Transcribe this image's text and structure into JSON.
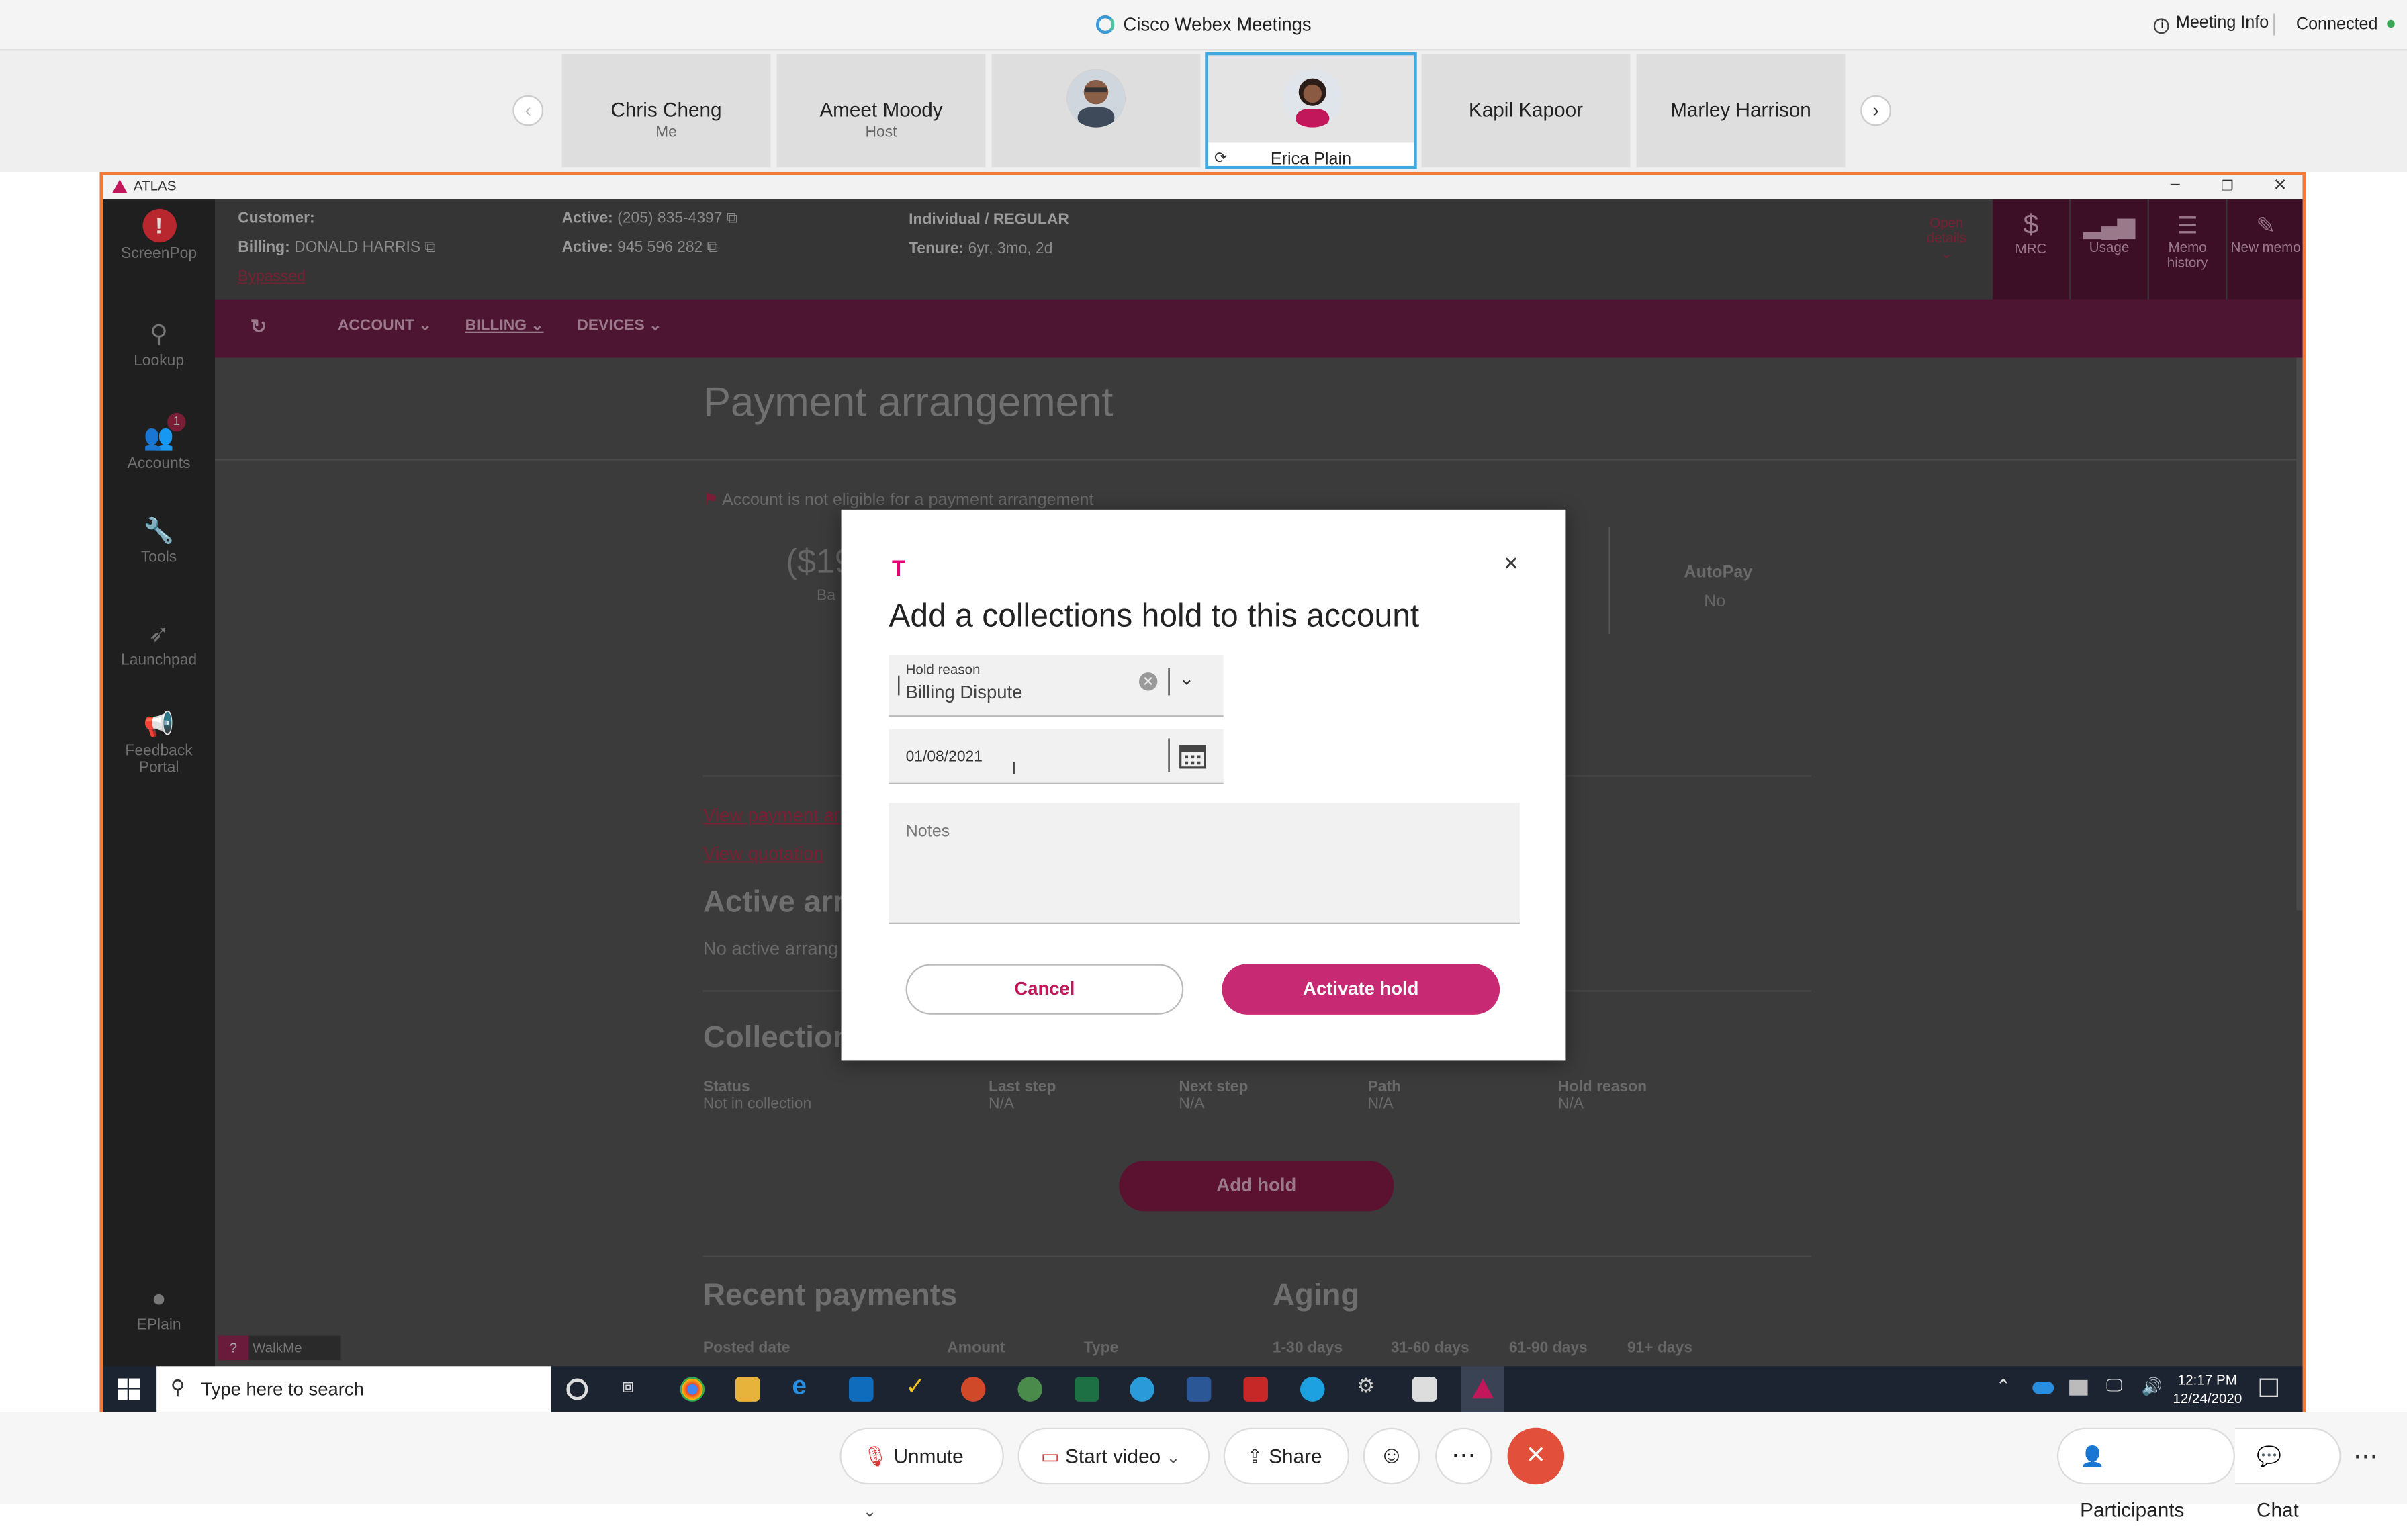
{
  "webex": {
    "app_title": "Cisco Webex Meetings",
    "meeting_info": "Meeting Info",
    "status": "Connected"
  },
  "participants": [
    {
      "name": "Chris Cheng",
      "role": "Me"
    },
    {
      "name": "Ameet Moody",
      "role": "Host"
    },
    {
      "name": "",
      "role": ""
    },
    {
      "name": "Erica Plain",
      "role": ""
    },
    {
      "name": "Kapil Kapoor",
      "role": ""
    },
    {
      "name": "Marley Harrison",
      "role": ""
    }
  ],
  "atlas": {
    "window_title": "ATLAS",
    "sidebar": [
      "ScreenPop",
      "Lookup",
      "Accounts",
      "Tools",
      "Launchpad",
      "Feedback Portal",
      "EPlain"
    ],
    "accounts_badge": "1",
    "customer": {
      "customer_label": "Customer:",
      "billing_label": "Billing:",
      "billing_name": "DONALD HARRIS",
      "bypassed": "Bypassed",
      "active_label": "Active:",
      "active1": "(205) 835-4397",
      "active2": "945 596 282",
      "type": "Individual",
      "plan": "REGULAR",
      "tenure_label": "Tenure:",
      "tenure": "6yr, 3mo, 2d"
    },
    "header_actions": [
      "Open details",
      "MRC",
      "Usage",
      "Memo history",
      "New memo"
    ],
    "nav": [
      "ACCOUNT",
      "BILLING",
      "DEVICES"
    ],
    "page": {
      "title": "Payment arrangement",
      "not_eligible": "Account is not eligible for a payment arrangement",
      "balance_partial": "($19",
      "balance_label_partial": "Ba",
      "autopay_label": "AutoPay",
      "autopay_value": "No",
      "link_view_payment": "View payment ar",
      "link_view_quotation": "View quotation",
      "active_arrangements": "Active arra",
      "no_active": "No active arrang",
      "collections": "Collection",
      "collections_cols": [
        {
          "label": "Status",
          "value": "Not in collection"
        },
        {
          "label": "Last step",
          "value": "N/A"
        },
        {
          "label": "Next step",
          "value": "N/A"
        },
        {
          "label": "Path",
          "value": "N/A"
        },
        {
          "label": "Hold reason",
          "value": "N/A"
        }
      ],
      "add_hold": "Add hold",
      "recent_payments": "Recent payments",
      "payments_cols": [
        "Posted date",
        "Amount",
        "Type"
      ],
      "aging": "Aging",
      "aging_cols": [
        "1-30 days",
        "31-60 days",
        "61-90 days",
        "91+ days"
      ],
      "walkme": "WalkMe"
    }
  },
  "modal": {
    "logo": "T",
    "title": "Add a collections hold to this account",
    "hold_reason_label": "Hold reason",
    "hold_reason_value": "Billing Dispute",
    "date_value": "01/08/2021",
    "notes_placeholder": "Notes",
    "cancel": "Cancel",
    "activate": "Activate hold"
  },
  "taskbar": {
    "search_placeholder": "Type here to search",
    "time": "12:17 PM",
    "date": "12/24/2020"
  },
  "controls": {
    "unmute": "Unmute",
    "start_video": "Start video",
    "share": "Share",
    "participants": "Participants",
    "chat": "Chat"
  }
}
